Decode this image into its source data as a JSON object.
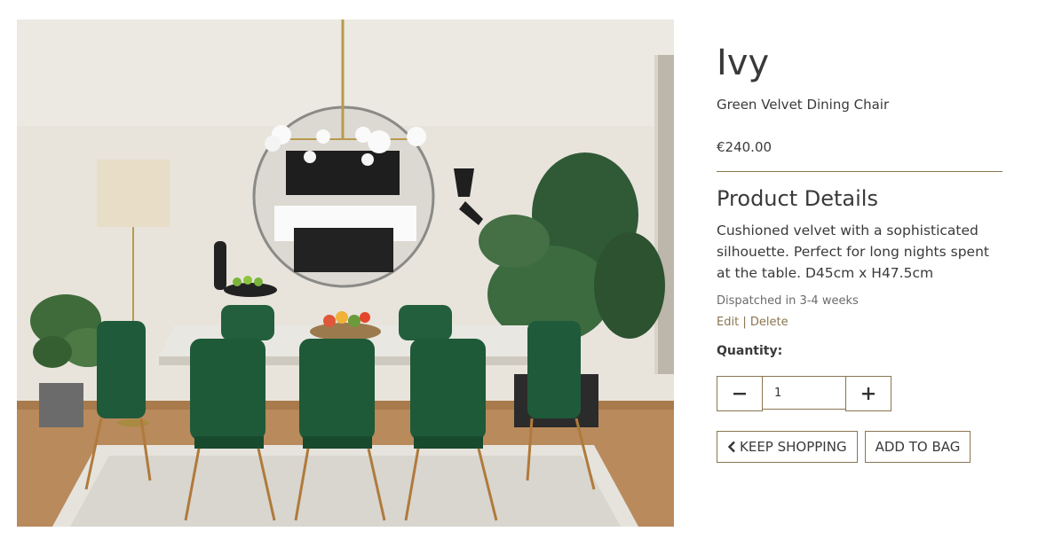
{
  "product": {
    "name": "Ivy",
    "subtitle": "Green Velvet Dining Chair",
    "price": "€240.00"
  },
  "details": {
    "heading": "Product Details",
    "description": "Cushioned velvet with a sophisticated silhouette. Perfect for long nights spent at the table. D45cm x H47.5cm",
    "dispatch": "Dispatched in 3-4 weeks"
  },
  "admin": {
    "edit_label": "Edit",
    "separator": "|",
    "delete_label": "Delete"
  },
  "quantity": {
    "label": "Quantity:",
    "value": "1"
  },
  "buttons": {
    "keep_shopping": "KEEP SHOPPING",
    "add_to_bag": "ADD TO BAG"
  },
  "icons": {
    "decrement": "minus-icon",
    "increment": "plus-icon",
    "back": "chevron-left-icon"
  },
  "colors": {
    "accent": "#8a7550",
    "text": "#3a3a3a"
  }
}
